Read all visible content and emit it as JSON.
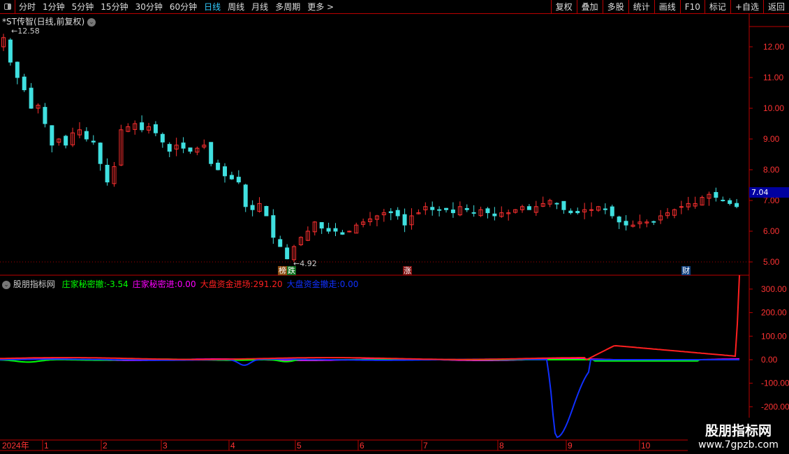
{
  "toolbar": {
    "periods": [
      "分时",
      "1分钟",
      "5分钟",
      "15分钟",
      "30分钟",
      "60分钟",
      "日线",
      "周线",
      "月线",
      "多周期",
      "更多 >"
    ],
    "active": "日线",
    "right_buttons": [
      "复权",
      "叠加",
      "多股",
      "统计",
      "画线",
      "F10",
      "标记",
      "+自选",
      "返回"
    ]
  },
  "chart": {
    "title": "*ST传智(日线,前复权)",
    "high_label": "12.58",
    "low_label": "4.92",
    "current_price": "7.04",
    "price_ticks": [
      "12.00",
      "11.00",
      "10.00",
      "9.00",
      "8.00",
      "7.00",
      "6.00",
      "5.00"
    ],
    "markers": [
      "榜",
      "跌",
      "涨",
      "财"
    ]
  },
  "indicator": {
    "name": "股朋指标网",
    "items": [
      {
        "label": "庄家秘密撤",
        "value": "-3.54",
        "color": "#00ff00"
      },
      {
        "label": "庄家秘密进",
        "value": "0.00",
        "color": "#ff00ff"
      },
      {
        "label": "大盘资金进场",
        "value": "291.20",
        "color": "#ff2020"
      },
      {
        "label": "大盘资金撤走",
        "value": "0.00",
        "color": "#1030ff"
      }
    ],
    "ticks": [
      "300.00",
      "200.00",
      "100.00",
      "0.00",
      "-100.00",
      "-200.00"
    ]
  },
  "xaxis": {
    "labels": [
      "2024年",
      "1",
      "2",
      "3",
      "4",
      "5",
      "6",
      "7",
      "8",
      "9",
      "10"
    ]
  },
  "watermark": {
    "line1": "股朋指标网",
    "line2": "www.7gpzb.com"
  },
  "chart_data": {
    "type": "candlestick",
    "closes": [
      12.3,
      11.5,
      11.0,
      10.6,
      10.0,
      10.1,
      9.5,
      8.8,
      9.0,
      8.8,
      9.2,
      9.3,
      9.0,
      8.9,
      8.2,
      7.6,
      8.1,
      9.3,
      9.4,
      9.5,
      9.3,
      9.4,
      9.2,
      8.9,
      8.6,
      8.8,
      8.7,
      8.6,
      8.7,
      8.8,
      8.2,
      8.0,
      7.8,
      7.7,
      7.6,
      6.8,
      6.7,
      6.9,
      6.5,
      5.8,
      5.5,
      5.1,
      5.5,
      5.8,
      6.0,
      6.3,
      6.1,
      6.0,
      6.0,
      5.9,
      6.0,
      6.2,
      6.3,
      6.4,
      6.5,
      6.6,
      6.6,
      6.5,
      6.2,
      6.5,
      6.6,
      6.8,
      6.7,
      6.7,
      6.7,
      6.6,
      6.8,
      6.7,
      6.6,
      6.7,
      6.6,
      6.5,
      6.6,
      6.6,
      6.7,
      6.8,
      6.7,
      6.8,
      6.9,
      7.0,
      6.9,
      6.7,
      6.6,
      6.6,
      6.7,
      6.7,
      6.8,
      6.7,
      6.5,
      6.3,
      6.2,
      6.2,
      6.3,
      6.3,
      6.3,
      6.5,
      6.6,
      6.7,
      6.8,
      6.9,
      6.9,
      7.1,
      7.2,
      7.1,
      7.0,
      6.9,
      6.8
    ],
    "price_range": [
      4.7,
      13.4
    ],
    "indicator_range": [
      -345,
      310
    ]
  }
}
